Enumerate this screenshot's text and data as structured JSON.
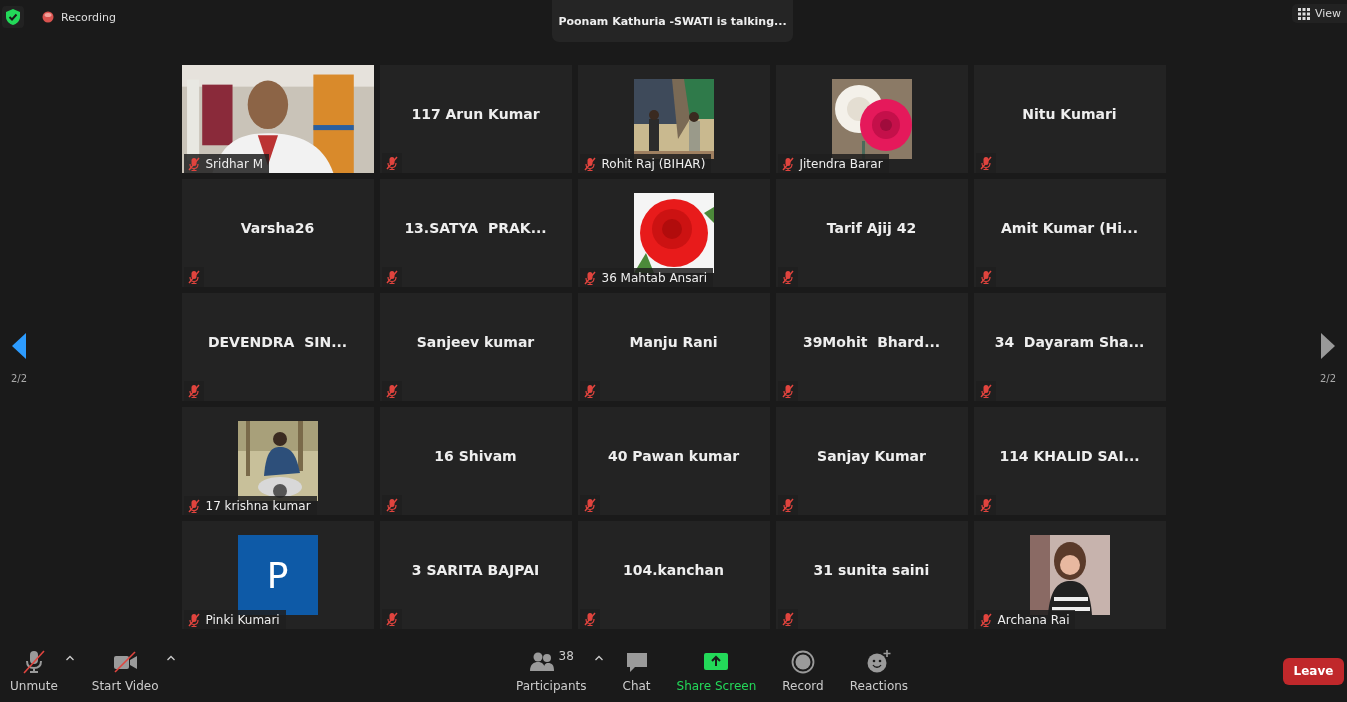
{
  "top_bar": {
    "recording_label": "Recording",
    "talking_banner": "Poonam Kathuria -SWATI is talking...",
    "view_button": "View"
  },
  "gallery": {
    "page_left": "2/2",
    "page_right": "2/2",
    "tiles": [
      {
        "kind": "video",
        "name": "Sridhar M",
        "muted": true
      },
      {
        "kind": "name",
        "name": "117 Arun Kumar",
        "muted": true
      },
      {
        "name": "Rohit Raj (BIHAR)",
        "muted": true
      },
      {
        "name": "Jitendra Barar",
        "muted": true
      },
      {
        "kind": "name",
        "name": "Nitu Kumari",
        "muted": true
      },
      {
        "kind": "name",
        "name": "Varsha26",
        "muted": true
      },
      {
        "kind": "name",
        "name": "13.SATYA  PRAK...",
        "muted": true
      },
      {
        "name": "36 Mahtab Ansari",
        "muted": true
      },
      {
        "kind": "name",
        "name": "Tarif Ajij 42",
        "muted": true
      },
      {
        "kind": "name",
        "name": "Amit Kumar (Hi...",
        "muted": true
      },
      {
        "kind": "name",
        "name": "DEVENDRA  SIN...",
        "muted": true
      },
      {
        "kind": "name",
        "name": "Sanjeev kumar",
        "muted": true
      },
      {
        "kind": "name",
        "name": "Manju Rani",
        "muted": true
      },
      {
        "kind": "name",
        "name": "39Mohit  Bhard...",
        "muted": true
      },
      {
        "kind": "name",
        "name": "34  Dayaram Sha...",
        "muted": true
      },
      {
        "name": "17 krishna kumar",
        "muted": true
      },
      {
        "kind": "name",
        "name": "16 Shivam",
        "muted": true
      },
      {
        "kind": "name",
        "name": "40 Pawan kumar",
        "muted": true
      },
      {
        "kind": "name",
        "name": "Sanjay Kumar",
        "muted": true
      },
      {
        "kind": "name",
        "name": "114 KHALID SAI...",
        "muted": true
      },
      {
        "kind": "avatar",
        "name": "Pinki Kumari",
        "initial": "P",
        "muted": true
      },
      {
        "kind": "name",
        "name": "3 SARITA BAJPAI",
        "muted": true
      },
      {
        "kind": "name",
        "name": "104.kanchan",
        "muted": true
      },
      {
        "kind": "name",
        "name": "31 sunita saini",
        "muted": true
      },
      {
        "name": "Archana Rai",
        "muted": true
      }
    ]
  },
  "toolbar": {
    "items": [
      {
        "kind": "mic",
        "label": "Unmute",
        "off": true,
        "caret": true
      },
      {
        "kind": "video",
        "label": "Start Video",
        "off": true,
        "caret": true
      },
      {
        "kind": "participants",
        "label": "Participants",
        "count": "38",
        "caret": true
      },
      {
        "kind": "chat",
        "label": "Chat"
      },
      {
        "kind": "share",
        "label": "Share Screen"
      },
      {
        "kind": "record",
        "label": "Record"
      },
      {
        "kind": "reactions",
        "label": "Reactions"
      }
    ],
    "leave_button": "Leave"
  }
}
